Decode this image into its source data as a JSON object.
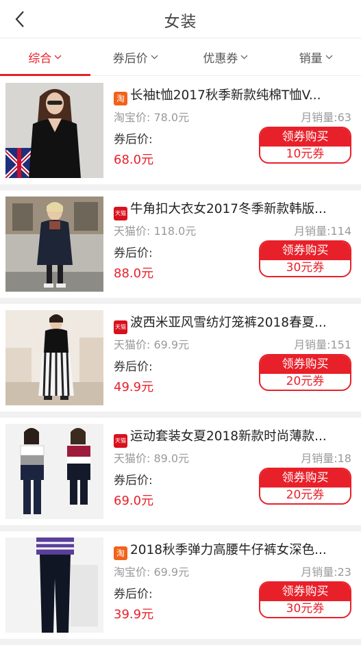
{
  "header": {
    "title": "女装"
  },
  "tabs": [
    {
      "label": "综合",
      "active": true
    },
    {
      "label": "券后价",
      "active": false
    },
    {
      "label": "优惠券",
      "active": false
    },
    {
      "label": "销量",
      "active": false
    }
  ],
  "colors": {
    "accent": "#e8202a",
    "taobao": "#f2621b",
    "tmall": "#d9111d"
  },
  "products": [
    {
      "shop": "taobao",
      "badge": "淘",
      "title": "长袖t恤2017秋季新款纯棉T恤V...",
      "orig_price": "淘宝价: 78.0元",
      "sales": "月销量:63",
      "after_label": "券后价:",
      "after_price": "68.0元",
      "buy_label": "领券购买",
      "coupon": "10元券"
    },
    {
      "shop": "tmall",
      "badge": "天猫",
      "title": "牛角扣大衣女2017冬季新款韩版...",
      "orig_price": "天猫价: 118.0元",
      "sales": "月销量:114",
      "after_label": "券后价:",
      "after_price": "88.0元",
      "buy_label": "领券购买",
      "coupon": "30元券"
    },
    {
      "shop": "tmall",
      "badge": "天猫",
      "title": "波西米亚风雪纺灯笼裤2018春夏...",
      "orig_price": "天猫价: 69.9元",
      "sales": "月销量:151",
      "after_label": "券后价:",
      "after_price": "49.9元",
      "buy_label": "领券购买",
      "coupon": "20元券"
    },
    {
      "shop": "tmall",
      "badge": "天猫",
      "title": "运动套装女夏2018新款时尚薄款...",
      "orig_price": "天猫价: 89.0元",
      "sales": "月销量:18",
      "after_label": "券后价:",
      "after_price": "69.0元",
      "buy_label": "领券购买",
      "coupon": "20元券"
    },
    {
      "shop": "taobao",
      "badge": "淘",
      "title": "2018秋季弹力高腰牛仔裤女深色...",
      "orig_price": "淘宝价: 69.9元",
      "sales": "月销量:23",
      "after_label": "券后价:",
      "after_price": "39.9元",
      "buy_label": "领券购买",
      "coupon": "30元券"
    }
  ]
}
